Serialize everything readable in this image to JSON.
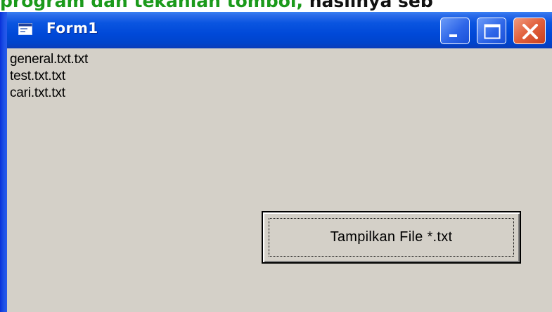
{
  "document": {
    "caption_green": "program dan tekanlah tombol,",
    "caption_black": " hasilnya seb"
  },
  "window": {
    "title": "Form1",
    "icon": "form-icon",
    "controls": {
      "minimize_icon": "minimize-icon",
      "maximize_icon": "maximize-icon",
      "close_icon": "close-icon"
    }
  },
  "files": [
    "general.txt.txt",
    "test.txt.txt",
    "cari.txt.txt"
  ],
  "button": {
    "label": "Tampilkan File *.txt"
  },
  "colors": {
    "titlebar": "#0049d8",
    "window_face": "#d4d0c8",
    "close_button": "#e1603c",
    "caption_green": "#1b9a1b"
  }
}
